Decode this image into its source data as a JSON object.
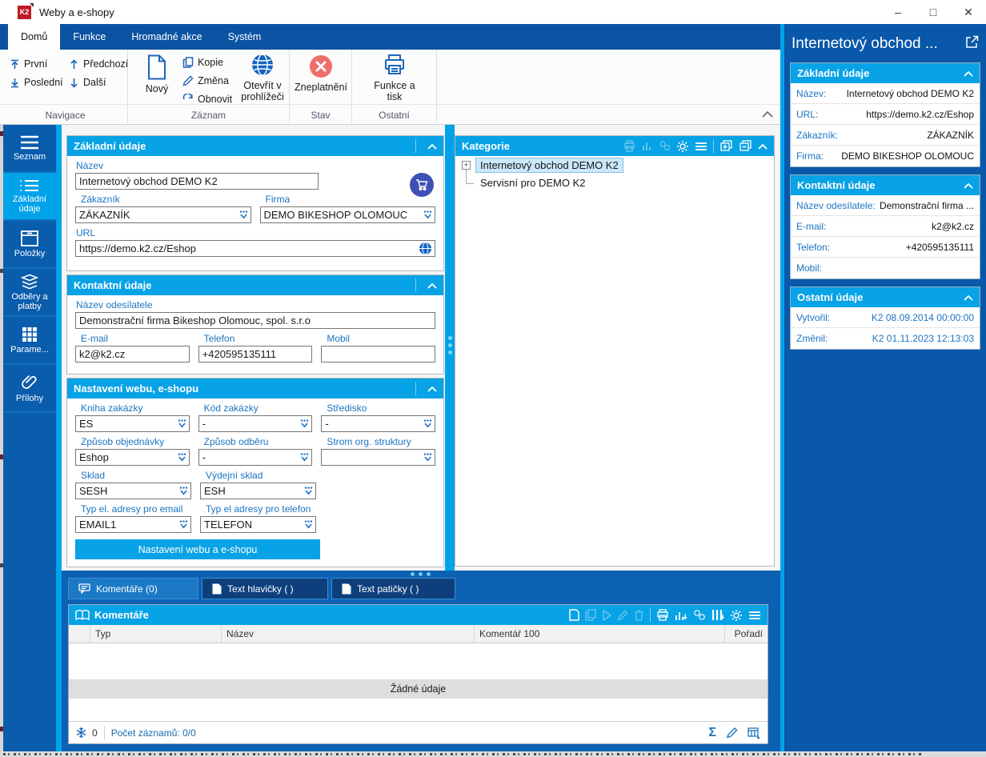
{
  "titlebar": {
    "logo_text": "K2",
    "title": "Weby a e-shopy",
    "minimize": "–",
    "maximize": "□",
    "close": "✕"
  },
  "ribbon": {
    "tabs": [
      {
        "label": "Domů"
      },
      {
        "label": "Funkce"
      },
      {
        "label": "Hromadné akce"
      },
      {
        "label": "Systém"
      }
    ],
    "nav": {
      "first": "První",
      "last": "Poslední",
      "prev": "Předchozí",
      "next": "Další",
      "group": "Navigace"
    },
    "record": {
      "new": "Nový",
      "copy": "Kopie",
      "change": "Změna",
      "refresh": "Obnovit",
      "open_browser": "Otevřít v prohlížeči",
      "group": "Záznam"
    },
    "state": {
      "invalidate": "Zneplatnění",
      "group": "Stav"
    },
    "other": {
      "func_print": "Funkce a tisk",
      "group": "Ostatní"
    }
  },
  "sidebar": {
    "items": [
      {
        "label": "Seznam"
      },
      {
        "label": "Základní údaje"
      },
      {
        "label": "Položky"
      },
      {
        "label": "Odběry a platby"
      },
      {
        "label": "Parame..."
      },
      {
        "label": "Přílohy"
      }
    ]
  },
  "form": {
    "basic": {
      "title": "Základní údaje",
      "nazev_label": "Název",
      "nazev": "Internetový obchod DEMO K2",
      "zakaznik_label": "Zákazník",
      "zakaznik": "ZÁKAZNÍK",
      "firma_label": "Firma",
      "firma": "DEMO BIKESHOP OLOMOUC",
      "url_label": "URL",
      "url": "https://demo.k2.cz/Eshop"
    },
    "contact": {
      "title": "Kontaktní údaje",
      "sender_label": "Název odesílatele",
      "sender": "Demonstrační firma Bikeshop Olomouc, spol. s.r.o",
      "email_label": "E-mail",
      "email": "k2@k2.cz",
      "phone_label": "Telefon",
      "phone": "+420595135111",
      "mobile_label": "Mobil",
      "mobile": ""
    },
    "web": {
      "title": "Nastavení webu, e-shopu",
      "kniha_label": "Kniha zakázky",
      "kniha": "ES",
      "kod_label": "Kód zakázky",
      "kod": "-",
      "stredisko_label": "Středisko",
      "stredisko": "-",
      "objednavky_label": "Způsob objednávky",
      "objednavky": "Eshop",
      "odberu_label": "Způsob odběru",
      "odberu": "-",
      "strom_label": "Strom org. struktury",
      "strom": "",
      "sklad_label": "Sklad",
      "sklad": "SESH",
      "vydejni_label": "Výdejní sklad",
      "vydejni": "ESH",
      "typ_email_label": "Typ el. adresy pro email",
      "typ_email": "EMAIL1",
      "typ_telefon_label": "Typ el adresy pro telefon",
      "typ_telefon": "TELEFON",
      "button": "Nastavení webu a e-shopu"
    }
  },
  "kategorie": {
    "title": "Kategorie",
    "expand_glyph": "+",
    "node1": "Internetový obchod DEMO K2",
    "node2": "Servisní pro DEMO K2"
  },
  "tabs_bottom": {
    "comments": "Komentáře (0)",
    "header_text": "Text hlavičky ( )",
    "footer_text": "Text patičky ( )"
  },
  "comments": {
    "title": "Komentáře",
    "col_typ": "Typ",
    "col_nazev": "Název",
    "col_komentar": "Komentář 100",
    "col_poradi": "Pořadí",
    "empty": "Žádné údaje",
    "frozen_count": "0",
    "records": "Počet záznamů: 0/0",
    "sum": "Σ"
  },
  "inspector": {
    "title": "Internetový obchod ...",
    "basic": {
      "title": "Základní údaje",
      "rows": [
        {
          "label": "Název:",
          "value": "Internetový obchod DEMO K2"
        },
        {
          "label": "URL:",
          "value": "https://demo.k2.cz/Eshop"
        },
        {
          "label": "Zákazník:",
          "value": "ZÁKAZNÍK"
        },
        {
          "label": "Firma:",
          "value": "DEMO BIKESHOP OLOMOUC"
        }
      ]
    },
    "contact": {
      "title": "Kontaktní údaje",
      "rows": [
        {
          "label": "Název odesílatele:",
          "value": "Demonstrační firma ..."
        },
        {
          "label": "E-mail:",
          "value": "k2@k2.cz"
        },
        {
          "label": "Telefon:",
          "value": "+420595135111"
        },
        {
          "label": "Mobil:",
          "value": ""
        }
      ]
    },
    "other": {
      "title": "Ostatní údaje",
      "rows": [
        {
          "label": "Vytvořil:",
          "value": "K2 08.09.2014 00:00:00"
        },
        {
          "label": "Změnil:",
          "value": "K2 01.11.2023 12:13:03"
        }
      ]
    }
  },
  "icons": {
    "dropdown": "dots-chevron",
    "globe": "globe",
    "cart": "shopping-cart",
    "invalidate": "red-x-circle",
    "print": "printer",
    "snowflake": "snowflake"
  },
  "colors": {
    "accent_cyan": "#00a2e8",
    "header_cyan": "#08a2e6",
    "app_blue": "#0c61b3",
    "navy_tab": "#0d3f7d",
    "active_tab_blue": "#1b79c6",
    "danger_red": "#ee6f68",
    "label_blue": "#1b74c0",
    "cart_indigo": "#3f51b5",
    "logo_red": "#c01a24"
  }
}
